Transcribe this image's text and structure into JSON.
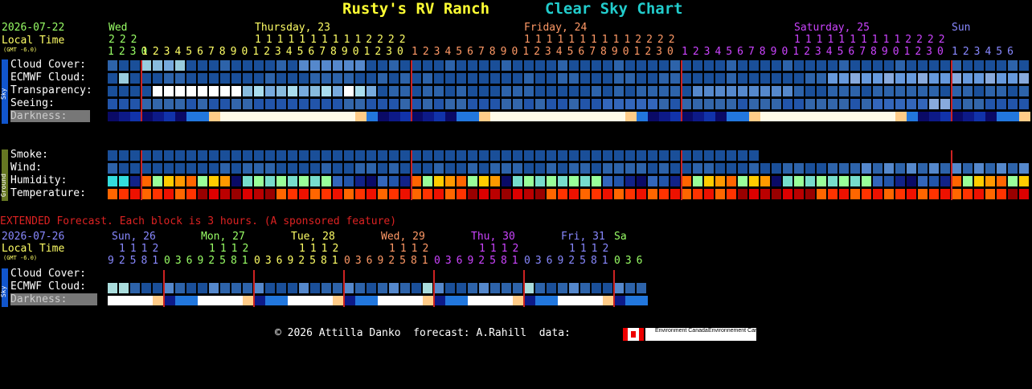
{
  "header": {
    "site": "Rusty's RV Ranch",
    "chart": "Clear Sky Chart"
  },
  "main": {
    "date": "2026-07-22",
    "local_time": "Local Time",
    "gmt": "(GMT -6.0)",
    "days": [
      {
        "label": "Wed",
        "color": "#99ff66"
      },
      {
        "label": "Thursday, 23",
        "color": "#ffff66"
      },
      {
        "label": "Friday, 24",
        "color": "#ff9966"
      },
      {
        "label": "Saturday, 25",
        "color": "#cc44ff"
      },
      {
        "label": "Sun",
        "color": "#8888ff"
      }
    ],
    "hour_tens": [
      {
        "text": "222",
        "color": "#99ff66"
      },
      {
        "text": "11111111112222",
        "color": "#ffff66"
      },
      {
        "text": "11111111112222",
        "color": "#ff9966"
      },
      {
        "text": "11111111112222",
        "color": "#cc44ff"
      }
    ],
    "hour_ones": [
      {
        "text": "1230",
        "color": "#99ff66"
      },
      {
        "text": "123456789012345678901230",
        "color": "#ffff66"
      },
      {
        "text": "123456789012345678901230",
        "color": "#ff9966"
      },
      {
        "text": "123456789012345678901230",
        "color": "#cc44ff"
      },
      {
        "text": "123456",
        "color": "#8888ff"
      }
    ],
    "sky_side": "Sky",
    "ground_side": "Ground",
    "rows": [
      {
        "label": "Cloud Cover:"
      },
      {
        "label": "ECMWF Cloud:"
      },
      {
        "label": "Transparency:"
      },
      {
        "label": "Seeing:"
      },
      {
        "label": "Darkness:"
      }
    ],
    "ground_rows": [
      {
        "label": "Smoke:"
      },
      {
        "label": "Wind:"
      },
      {
        "label": "Humidity:"
      },
      {
        "label": "Temperature:"
      }
    ]
  },
  "extended": {
    "notice": "EXTENDED Forecast. Each block is 3 hours. (A sponsored feature)",
    "date": "2026-07-26",
    "local_time": "Local Time",
    "gmt": "(GMT -6.0)",
    "days": [
      {
        "label": "Sun, 26",
        "color": "#8888ff"
      },
      {
        "label": "Mon, 27",
        "color": "#99ff66"
      },
      {
        "label": "Tue, 28",
        "color": "#ffff66"
      },
      {
        "label": "Wed, 29",
        "color": "#ff9966"
      },
      {
        "label": "Thu, 30",
        "color": "#cc44ff"
      },
      {
        "label": "Fri, 31",
        "color": "#8888ff"
      },
      {
        "label": "Sa",
        "color": "#99ff66"
      }
    ],
    "tens": "1112",
    "ones": [
      {
        "text": "92581",
        "color": "#8888ff"
      },
      {
        "text": "03692581",
        "color": "#99ff66"
      },
      {
        "text": "03692581",
        "color": "#ffff66"
      },
      {
        "text": "03692581",
        "color": "#ff9966"
      },
      {
        "text": "03692581",
        "color": "#cc44ff"
      },
      {
        "text": "03692581",
        "color": "#8888ff"
      },
      {
        "text": "036",
        "color": "#99ff66"
      }
    ],
    "rows": [
      {
        "label": "Cloud Cover:"
      },
      {
        "label": "ECMWF Cloud:"
      },
      {
        "label": "Darkness:"
      }
    ]
  },
  "footer": {
    "copyright": "© 2026 Attilla Danko  forecast: A.Rahill  data:",
    "logo1": "Environment Canada",
    "logo2": "Environnement Canada"
  }
}
